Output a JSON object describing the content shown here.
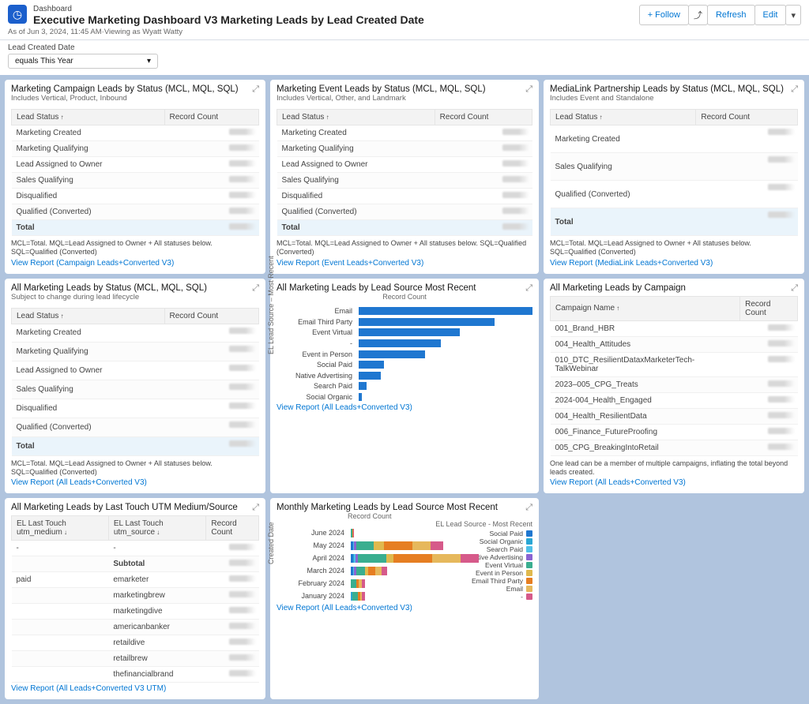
{
  "header": {
    "crumb": "Dashboard",
    "title": "Executive Marketing Dashboard V3 Marketing Leads by Lead Created Date",
    "asof": "As of Jun 3, 2024, 11:45 AM·Viewing as Wyatt Watty",
    "actions": {
      "follow": "+  Follow",
      "refresh": "Refresh",
      "edit": "Edit",
      "caret": "▾",
      "share": "⤴"
    }
  },
  "filter": {
    "label": "Lead Created Date",
    "value": "equals This Year"
  },
  "colors": {
    "series": [
      "#1f77d0",
      "#2aa6d4",
      "#4fc0e8",
      "#8a63d2",
      "#e67e22",
      "#e0b94e",
      "#3aae8f",
      "#d65a8a",
      "#e6b85c"
    ]
  },
  "cards": {
    "campaign": {
      "title": "Marketing Campaign Leads by Status (MCL, MQL, SQL)",
      "sub": "Includes Vertical, Product, Inbound",
      "headers": [
        "Lead Status",
        "Record Count"
      ],
      "rows": [
        "Marketing Created",
        "Marketing Qualifying",
        "Lead Assigned to Owner",
        "Sales Qualifying",
        "Disqualified",
        "Qualified (Converted)"
      ],
      "total": "Total",
      "foot": "MCL=Total. MQL=Lead Assigned to Owner + All statuses below. SQL=Qualified (Converted)",
      "link": "View Report (Campaign Leads+Converted V3)"
    },
    "event": {
      "title": "Marketing Event Leads by Status (MCL, MQL, SQL)",
      "sub": "Includes Vertical, Other, and Landmark",
      "headers": [
        "Lead Status",
        "Record Count"
      ],
      "rows": [
        "Marketing Created",
        "Marketing Qualifying",
        "Lead Assigned to Owner",
        "Sales Qualifying",
        "Disqualified",
        "Qualified (Converted)"
      ],
      "total": "Total",
      "foot": "MCL=Total. MQL=Lead Assigned to Owner + All statuses below. SQL=Qualified (Converted)",
      "link": "View Report (Event Leads+Converted V3)"
    },
    "medialink": {
      "title": "MediaLink Partnership Leads by Status (MCL, MQL, SQL)",
      "sub": "Includes Event and Standalone",
      "headers": [
        "Lead Status",
        "Record Count"
      ],
      "rows": [
        "Marketing Created",
        "Sales Qualifying",
        "Qualified (Converted)"
      ],
      "total": "Total",
      "foot": "MCL=Total. MQL=Lead Assigned to Owner + All statuses below. SQL=Qualified (Converted)",
      "link": "View Report (MediaLink Leads+Converted V3)"
    },
    "allstatus": {
      "title": "All Marketing Leads by Status (MCL, MQL, SQL)",
      "sub": "Subject to change during lead lifecycle",
      "headers": [
        "Lead Status",
        "Record Count"
      ],
      "rows": [
        "Marketing Created",
        "Marketing Qualifying",
        "Lead Assigned to Owner",
        "Sales Qualifying",
        "Disqualified",
        "Qualified (Converted)"
      ],
      "total": "Total",
      "foot": "MCL=Total. MQL=Lead Assigned to Owner + All statuses below. SQL=Qualified (Converted)",
      "link": "View Report (All Leads+Converted V3)"
    },
    "bysource": {
      "title": "All Marketing Leads by Lead Source Most Recent",
      "axis_top": "Record Count",
      "axis_left": "EL Lead Source – Most Recent",
      "link": "View Report (All Leads+Converted V3)"
    },
    "bycampaign": {
      "title": "All Marketing Leads by Campaign",
      "headers": [
        "Campaign Name",
        "Record Count"
      ],
      "rows": [
        "001_Brand_HBR",
        "004_Health_Attitudes",
        "010_DTC_ResilientDataxMarketerTech-TalkWebinar",
        "2023–005_CPG_Treats",
        "2024-004_Health_Engaged",
        "004_Health_ResilientData",
        "006_Finance_FutureProofing",
        "005_CPG_BreakingIntoRetail"
      ],
      "foot": "One lead can be a member of multiple campaigns, inflating the total beyond leads created.",
      "link": "View Report (All Leads+Converted V3)"
    },
    "byutm": {
      "title": "All Marketing Leads by Last Touch UTM Medium/Source",
      "headers": [
        "EL Last Touch utm_medium",
        "EL Last Touch utm_source",
        "Record Count"
      ],
      "group1": {
        "medium": "-",
        "sources": [
          "-",
          "Subtotal"
        ]
      },
      "group2": {
        "medium": "paid",
        "sources": [
          "emarketer",
          "marketingbrew",
          "marketingdive",
          "americanbanker",
          "retaildive",
          "retailbrew",
          "thefinancialbrand"
        ]
      },
      "link": "View Report (All Leads+Converted V3 UTM)"
    },
    "monthly": {
      "title": "Monthly Marketing Leads by Lead Source Most Recent",
      "axis_top": "Record Count",
      "axis_left": "Created Date",
      "legend_title": "EL Lead Source - Most Recent",
      "legend": [
        "Social Paid",
        "Social Organic",
        "Search Paid",
        "Native Advertising",
        "Event Virtual",
        "Event in Person",
        "Email Third Party",
        "Email",
        "-"
      ],
      "link": "View Report (All Leads+Converted V3)"
    }
  },
  "chart_data": [
    {
      "type": "bar",
      "orientation": "horizontal",
      "title": "All Marketing Leads by Lead Source Most Recent",
      "xlabel": "Record Count",
      "ylabel": "EL Lead Source – Most Recent",
      "categories": [
        "Email",
        "Email Third Party",
        "Event Virtual",
        "-",
        "Event in Person",
        "Social Paid",
        "Native Advertising",
        "Search Paid",
        "Social Organic"
      ],
      "values": [
        275,
        215,
        160,
        130,
        105,
        40,
        35,
        12,
        5
      ],
      "xlim": [
        0,
        300
      ]
    },
    {
      "type": "bar_stacked",
      "orientation": "horizontal",
      "title": "Monthly Marketing Leads by Lead Source Most Recent",
      "xlabel": "Record Count",
      "ylabel": "Created Date",
      "categories": [
        "June 2024",
        "May 2024",
        "April 2024",
        "March 2024",
        "February 2024",
        "January 2024"
      ],
      "series": [
        {
          "name": "Social Paid",
          "color": "#1f77d0",
          "values": [
            0,
            3,
            3,
            3,
            0,
            0
          ]
        },
        {
          "name": "Social Organic",
          "color": "#2aa6d4",
          "values": [
            0,
            0,
            2,
            0,
            0,
            2
          ]
        },
        {
          "name": "Search Paid",
          "color": "#4fc0e8",
          "values": [
            0,
            2,
            2,
            2,
            0,
            0
          ]
        },
        {
          "name": "Native Advertising",
          "color": "#8a63d2",
          "values": [
            0,
            3,
            3,
            3,
            0,
            0
          ]
        },
        {
          "name": "Event Virtual",
          "color": "#3aae8f",
          "values": [
            2,
            24,
            40,
            12,
            8,
            8
          ]
        },
        {
          "name": "Event in Person",
          "color": "#e0b94e",
          "values": [
            0,
            15,
            10,
            5,
            0,
            0
          ]
        },
        {
          "name": "Email Third Party",
          "color": "#e67e22",
          "values": [
            1,
            40,
            55,
            10,
            3,
            3
          ]
        },
        {
          "name": "Email",
          "color": "#e6b85c",
          "values": [
            0,
            25,
            40,
            8,
            5,
            3
          ]
        },
        {
          "name": "-",
          "color": "#d65a8a",
          "values": [
            2,
            18,
            25,
            8,
            4,
            4
          ]
        }
      ],
      "xlim": [
        0,
        200
      ]
    }
  ]
}
